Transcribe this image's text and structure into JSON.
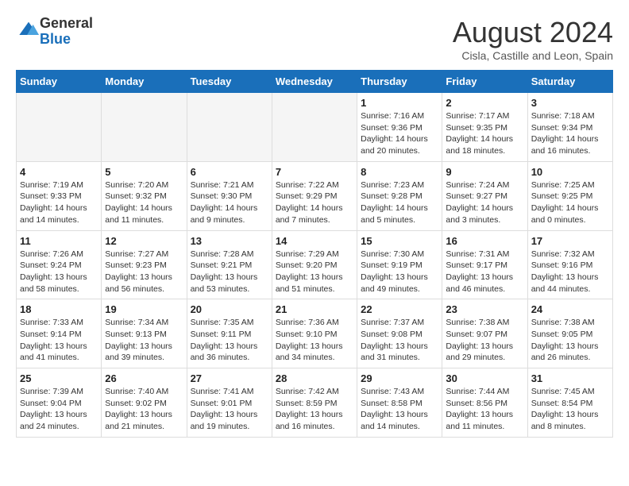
{
  "header": {
    "logo": {
      "general": "General",
      "blue": "Blue"
    },
    "title": "August 2024",
    "subtitle": "Cisla, Castille and Leon, Spain"
  },
  "days_of_week": [
    "Sunday",
    "Monday",
    "Tuesday",
    "Wednesday",
    "Thursday",
    "Friday",
    "Saturday"
  ],
  "weeks": [
    [
      {
        "day": "",
        "info": ""
      },
      {
        "day": "",
        "info": ""
      },
      {
        "day": "",
        "info": ""
      },
      {
        "day": "",
        "info": ""
      },
      {
        "day": "1",
        "info": "Sunrise: 7:16 AM\nSunset: 9:36 PM\nDaylight: 14 hours and 20 minutes."
      },
      {
        "day": "2",
        "info": "Sunrise: 7:17 AM\nSunset: 9:35 PM\nDaylight: 14 hours and 18 minutes."
      },
      {
        "day": "3",
        "info": "Sunrise: 7:18 AM\nSunset: 9:34 PM\nDaylight: 14 hours and 16 minutes."
      }
    ],
    [
      {
        "day": "4",
        "info": "Sunrise: 7:19 AM\nSunset: 9:33 PM\nDaylight: 14 hours and 14 minutes."
      },
      {
        "day": "5",
        "info": "Sunrise: 7:20 AM\nSunset: 9:32 PM\nDaylight: 14 hours and 11 minutes."
      },
      {
        "day": "6",
        "info": "Sunrise: 7:21 AM\nSunset: 9:30 PM\nDaylight: 14 hours and 9 minutes."
      },
      {
        "day": "7",
        "info": "Sunrise: 7:22 AM\nSunset: 9:29 PM\nDaylight: 14 hours and 7 minutes."
      },
      {
        "day": "8",
        "info": "Sunrise: 7:23 AM\nSunset: 9:28 PM\nDaylight: 14 hours and 5 minutes."
      },
      {
        "day": "9",
        "info": "Sunrise: 7:24 AM\nSunset: 9:27 PM\nDaylight: 14 hours and 3 minutes."
      },
      {
        "day": "10",
        "info": "Sunrise: 7:25 AM\nSunset: 9:25 PM\nDaylight: 14 hours and 0 minutes."
      }
    ],
    [
      {
        "day": "11",
        "info": "Sunrise: 7:26 AM\nSunset: 9:24 PM\nDaylight: 13 hours and 58 minutes."
      },
      {
        "day": "12",
        "info": "Sunrise: 7:27 AM\nSunset: 9:23 PM\nDaylight: 13 hours and 56 minutes."
      },
      {
        "day": "13",
        "info": "Sunrise: 7:28 AM\nSunset: 9:21 PM\nDaylight: 13 hours and 53 minutes."
      },
      {
        "day": "14",
        "info": "Sunrise: 7:29 AM\nSunset: 9:20 PM\nDaylight: 13 hours and 51 minutes."
      },
      {
        "day": "15",
        "info": "Sunrise: 7:30 AM\nSunset: 9:19 PM\nDaylight: 13 hours and 49 minutes."
      },
      {
        "day": "16",
        "info": "Sunrise: 7:31 AM\nSunset: 9:17 PM\nDaylight: 13 hours and 46 minutes."
      },
      {
        "day": "17",
        "info": "Sunrise: 7:32 AM\nSunset: 9:16 PM\nDaylight: 13 hours and 44 minutes."
      }
    ],
    [
      {
        "day": "18",
        "info": "Sunrise: 7:33 AM\nSunset: 9:14 PM\nDaylight: 13 hours and 41 minutes."
      },
      {
        "day": "19",
        "info": "Sunrise: 7:34 AM\nSunset: 9:13 PM\nDaylight: 13 hours and 39 minutes."
      },
      {
        "day": "20",
        "info": "Sunrise: 7:35 AM\nSunset: 9:11 PM\nDaylight: 13 hours and 36 minutes."
      },
      {
        "day": "21",
        "info": "Sunrise: 7:36 AM\nSunset: 9:10 PM\nDaylight: 13 hours and 34 minutes."
      },
      {
        "day": "22",
        "info": "Sunrise: 7:37 AM\nSunset: 9:08 PM\nDaylight: 13 hours and 31 minutes."
      },
      {
        "day": "23",
        "info": "Sunrise: 7:38 AM\nSunset: 9:07 PM\nDaylight: 13 hours and 29 minutes."
      },
      {
        "day": "24",
        "info": "Sunrise: 7:38 AM\nSunset: 9:05 PM\nDaylight: 13 hours and 26 minutes."
      }
    ],
    [
      {
        "day": "25",
        "info": "Sunrise: 7:39 AM\nSunset: 9:04 PM\nDaylight: 13 hours and 24 minutes."
      },
      {
        "day": "26",
        "info": "Sunrise: 7:40 AM\nSunset: 9:02 PM\nDaylight: 13 hours and 21 minutes."
      },
      {
        "day": "27",
        "info": "Sunrise: 7:41 AM\nSunset: 9:01 PM\nDaylight: 13 hours and 19 minutes."
      },
      {
        "day": "28",
        "info": "Sunrise: 7:42 AM\nSunset: 8:59 PM\nDaylight: 13 hours and 16 minutes."
      },
      {
        "day": "29",
        "info": "Sunrise: 7:43 AM\nSunset: 8:58 PM\nDaylight: 13 hours and 14 minutes."
      },
      {
        "day": "30",
        "info": "Sunrise: 7:44 AM\nSunset: 8:56 PM\nDaylight: 13 hours and 11 minutes."
      },
      {
        "day": "31",
        "info": "Sunrise: 7:45 AM\nSunset: 8:54 PM\nDaylight: 13 hours and 8 minutes."
      }
    ]
  ],
  "accent_color": "#1a6fba"
}
